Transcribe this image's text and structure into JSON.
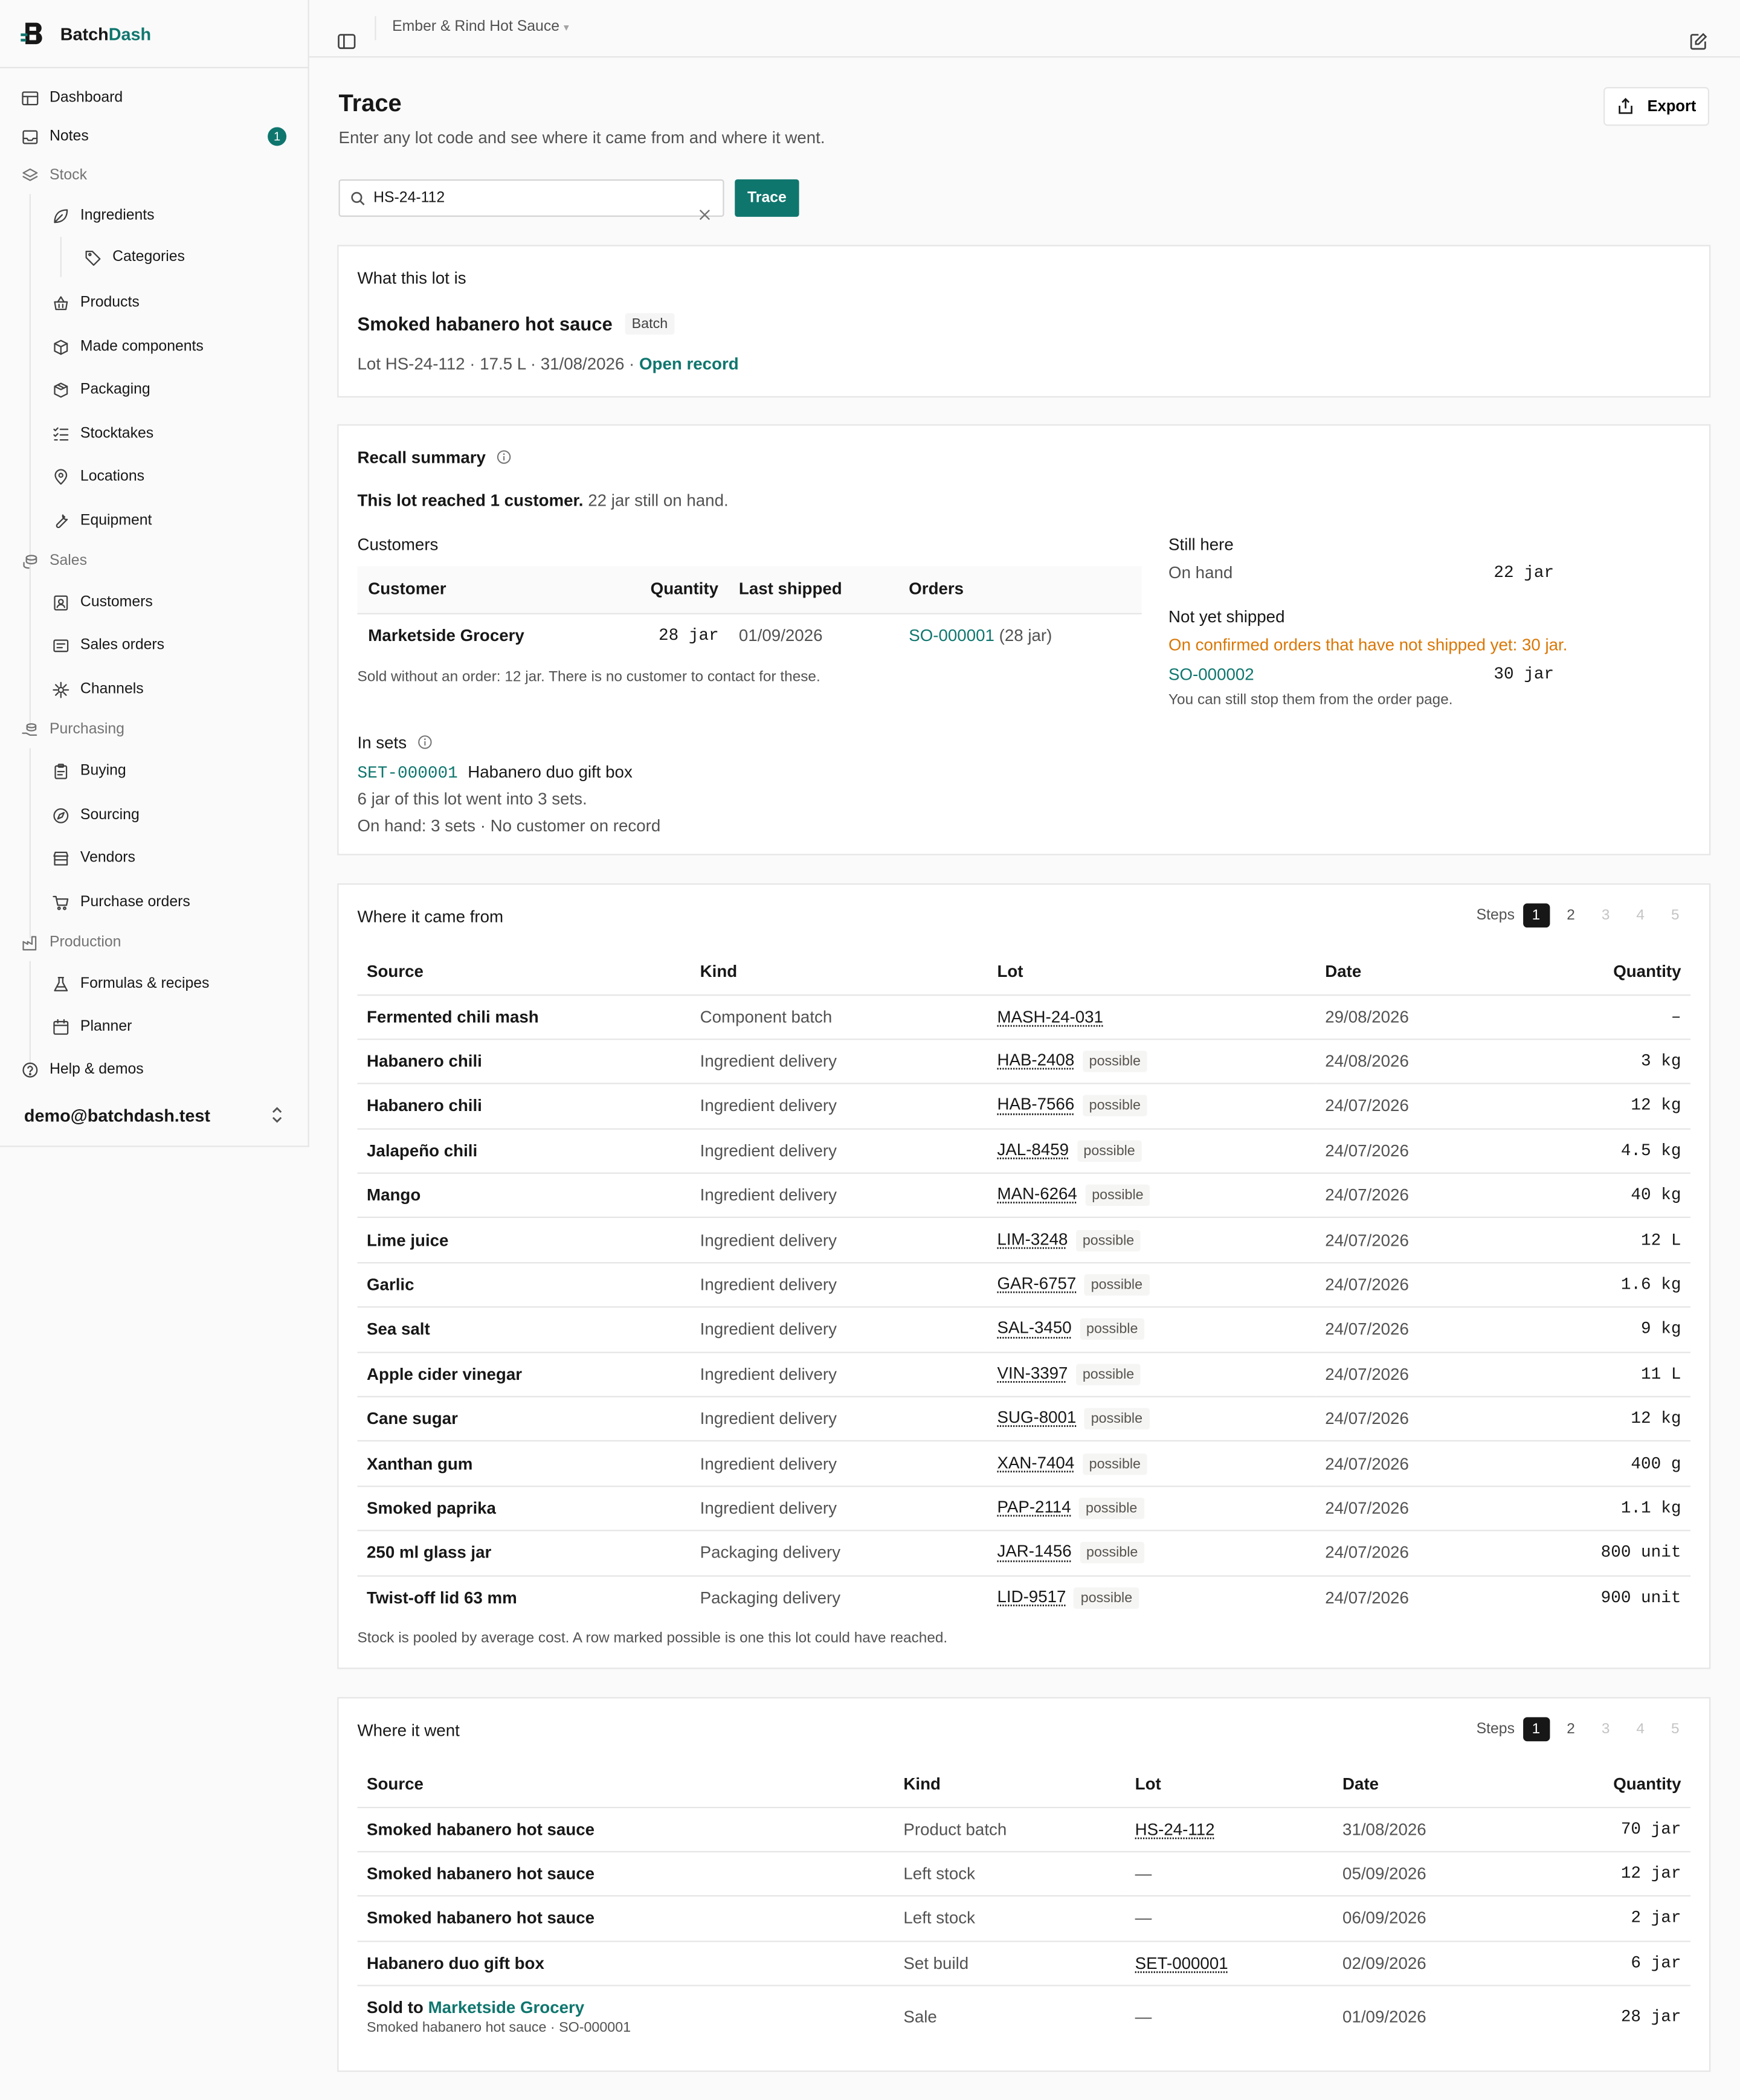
{
  "brand": {
    "part1": "Batch",
    "part2": "Dash"
  },
  "breadcrumb": {
    "label": "Ember & Rind Hot Sauce"
  },
  "sidebar": {
    "items": [
      {
        "key": "dashboard",
        "label": "Dashboard",
        "icon": "layout-icon"
      },
      {
        "key": "notes",
        "label": "Notes",
        "icon": "inbox-icon",
        "badge": "1"
      },
      {
        "key": "stock",
        "label": "Stock",
        "icon": "layers-icon"
      },
      {
        "key": "ingredients",
        "label": "Ingredients",
        "icon": "leaf-icon"
      },
      {
        "key": "categories",
        "label": "Categories",
        "icon": "tag-icon"
      },
      {
        "key": "products",
        "label": "Products",
        "icon": "basket-icon"
      },
      {
        "key": "made-components",
        "label": "Made components",
        "icon": "box-icon"
      },
      {
        "key": "packaging",
        "label": "Packaging",
        "icon": "package-icon"
      },
      {
        "key": "stocktakes",
        "label": "Stocktakes",
        "icon": "list-checks-icon"
      },
      {
        "key": "locations",
        "label": "Locations",
        "icon": "map-pin-icon"
      },
      {
        "key": "equipment",
        "label": "Equipment",
        "icon": "wrench-icon"
      },
      {
        "key": "sales",
        "label": "Sales",
        "icon": "coins-icon"
      },
      {
        "key": "customers",
        "label": "Customers",
        "icon": "contact-icon"
      },
      {
        "key": "sales-orders",
        "label": "Sales orders",
        "icon": "receipt-icon"
      },
      {
        "key": "channels",
        "label": "Channels",
        "icon": "sparkle-icon"
      },
      {
        "key": "purchasing",
        "label": "Purchasing",
        "icon": "hand-coins-icon"
      },
      {
        "key": "buying",
        "label": "Buying",
        "icon": "clipboard-icon"
      },
      {
        "key": "sourcing",
        "label": "Sourcing",
        "icon": "compass-icon"
      },
      {
        "key": "vendors",
        "label": "Vendors",
        "icon": "store-icon"
      },
      {
        "key": "purchase-orders",
        "label": "Purchase orders",
        "icon": "cart-icon"
      },
      {
        "key": "production",
        "label": "Production",
        "icon": "factory-icon"
      },
      {
        "key": "formulas",
        "label": "Formulas & recipes",
        "icon": "flask-icon"
      },
      {
        "key": "planner",
        "label": "Planner",
        "icon": "calendar-icon"
      },
      {
        "key": "help",
        "label": "Help & demos",
        "icon": "help-circle-icon"
      }
    ],
    "user": "demo@batchdash.test"
  },
  "page": {
    "title": "Trace",
    "subtitle": "Enter any lot code and see where it came from and where it went.",
    "export_label": "Export",
    "search_value": "HS-24-112",
    "trace_label": "Trace"
  },
  "lot": {
    "heading": "What this lot is",
    "name": "Smoked habanero hot sauce",
    "tag": "Batch",
    "meta": "Lot HS-24-112 · 17.5 L · 31/08/2026 ·",
    "open_record": "Open record"
  },
  "recall": {
    "heading": "Recall summary",
    "reached": "This lot reached 1 customer.",
    "on_hand_note": "22 jar still on hand.",
    "customers_label": "Customers",
    "customers_cols": [
      "Customer",
      "Quantity",
      "Last shipped",
      "Orders"
    ],
    "customers_rows": [
      {
        "customer": "Marketside Grocery",
        "quantity": "28 jar",
        "last_shipped": "01/09/2026",
        "order": "SO-000001",
        "order_qty": "(28 jar)"
      }
    ],
    "sold_without": "Sold without an order: 12 jar. There is no customer to contact for these.",
    "still_here_label": "Still here",
    "on_hand_label": "On hand",
    "on_hand_value": "22 jar",
    "not_shipped_label": "Not yet shipped",
    "not_shipped_warning": "On confirmed orders that have not shipped yet: 30 jar.",
    "not_shipped_order": "SO-000002",
    "not_shipped_qty": "30 jar",
    "not_shipped_note": "You can still stop them from the order page.",
    "sets_label": "In sets",
    "set_code": "SET-000001",
    "set_name": "Habanero duo gift box",
    "set_line1": "6 jar of this lot went into 3 sets.",
    "set_line2": "On hand: 3 sets · No customer on record"
  },
  "came_from": {
    "heading": "Where it came from",
    "steps_label": "Steps",
    "steps": [
      "1",
      "2",
      "3",
      "4",
      "5"
    ],
    "cols": [
      "Source",
      "Kind",
      "Lot",
      "Date",
      "Quantity"
    ],
    "rows": [
      {
        "source": "Fermented chili mash",
        "kind": "Component batch",
        "lot": "MASH-24-031",
        "possible": "",
        "date": "29/08/2026",
        "qty": "–"
      },
      {
        "source": "Habanero chili",
        "kind": "Ingredient delivery",
        "lot": "HAB-2408",
        "possible": "possible",
        "date": "24/08/2026",
        "qty": "3 kg"
      },
      {
        "source": "Habanero chili",
        "kind": "Ingredient delivery",
        "lot": "HAB-7566",
        "possible": "possible",
        "date": "24/07/2026",
        "qty": "12 kg"
      },
      {
        "source": "Jalapeño chili",
        "kind": "Ingredient delivery",
        "lot": "JAL-8459",
        "possible": "possible",
        "date": "24/07/2026",
        "qty": "4.5 kg"
      },
      {
        "source": "Mango",
        "kind": "Ingredient delivery",
        "lot": "MAN-6264",
        "possible": "possible",
        "date": "24/07/2026",
        "qty": "40 kg"
      },
      {
        "source": "Lime juice",
        "kind": "Ingredient delivery",
        "lot": "LIM-3248",
        "possible": "possible",
        "date": "24/07/2026",
        "qty": "12 L"
      },
      {
        "source": "Garlic",
        "kind": "Ingredient delivery",
        "lot": "GAR-6757",
        "possible": "possible",
        "date": "24/07/2026",
        "qty": "1.6 kg"
      },
      {
        "source": "Sea salt",
        "kind": "Ingredient delivery",
        "lot": "SAL-3450",
        "possible": "possible",
        "date": "24/07/2026",
        "qty": "9 kg"
      },
      {
        "source": "Apple cider vinegar",
        "kind": "Ingredient delivery",
        "lot": "VIN-3397",
        "possible": "possible",
        "date": "24/07/2026",
        "qty": "11 L"
      },
      {
        "source": "Cane sugar",
        "kind": "Ingredient delivery",
        "lot": "SUG-8001",
        "possible": "possible",
        "date": "24/07/2026",
        "qty": "12 kg"
      },
      {
        "source": "Xanthan gum",
        "kind": "Ingredient delivery",
        "lot": "XAN-7404",
        "possible": "possible",
        "date": "24/07/2026",
        "qty": "400 g"
      },
      {
        "source": "Smoked paprika",
        "kind": "Ingredient delivery",
        "lot": "PAP-2114",
        "possible": "possible",
        "date": "24/07/2026",
        "qty": "1.1 kg"
      },
      {
        "source": "250 ml glass jar",
        "kind": "Packaging delivery",
        "lot": "JAR-1456",
        "possible": "possible",
        "date": "24/07/2026",
        "qty": "800 unit"
      },
      {
        "source": "Twist-off lid 63 mm",
        "kind": "Packaging delivery",
        "lot": "LID-9517",
        "possible": "possible",
        "date": "24/07/2026",
        "qty": "900 unit"
      }
    ],
    "footnote": "Stock is pooled by average cost. A row marked possible is one this lot could have reached."
  },
  "went": {
    "heading": "Where it went",
    "steps_label": "Steps",
    "steps": [
      "1",
      "2",
      "3",
      "4",
      "5"
    ],
    "cols": [
      "Source",
      "Kind",
      "Lot",
      "Date",
      "Quantity"
    ],
    "rows": [
      {
        "source": "Smoked habanero hot sauce",
        "kind": "Product batch",
        "lot": "HS-24-112",
        "date": "31/08/2026",
        "qty": "70 jar"
      },
      {
        "source": "Smoked habanero hot sauce",
        "kind": "Left stock",
        "lot": "—",
        "date": "05/09/2026",
        "qty": "12 jar"
      },
      {
        "source": "Smoked habanero hot sauce",
        "kind": "Left stock",
        "lot": "—",
        "date": "06/09/2026",
        "qty": "2 jar"
      },
      {
        "source": "Habanero duo gift box",
        "kind": "Set build",
        "lot": "SET-000001",
        "date": "02/09/2026",
        "qty": "6 jar"
      }
    ],
    "sold": {
      "prefix": "Sold to",
      "customer": "Marketside Grocery",
      "sub": "Smoked habanero hot sauce · SO-000001",
      "kind": "Sale",
      "lot": "—",
      "date": "01/09/2026",
      "qty": "28 jar"
    }
  }
}
